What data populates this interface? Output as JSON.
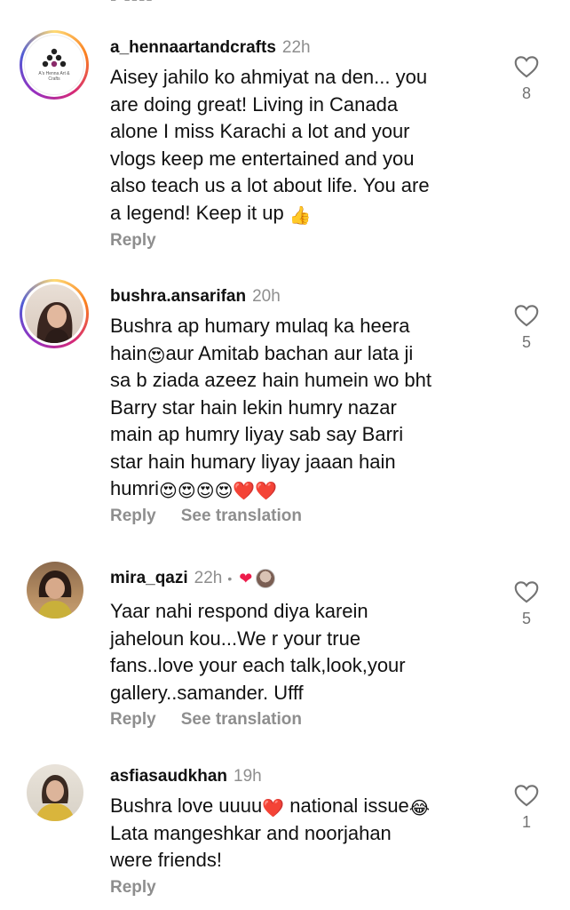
{
  "top_fragment": "- ----",
  "comments": [
    {
      "username": "a_hennaartandcrafts",
      "time": "22h",
      "text_lines": [
        "Aisey jahilo ko ahmiyat na den... you",
        "are doing great! Living in Canada",
        "alone I miss Karachi a lot and your",
        "vlogs keep me entertained and you",
        "also teach us a lot about life. You are",
        "a legend! Keep it up"
      ],
      "text_end_emoji": "👍",
      "reply": "Reply",
      "likes": "8",
      "avatar_caption": "A's Henna Art & Crafts",
      "avatar_icon": "henna-logo-icon"
    },
    {
      "username": "bushra.ansarifan",
      "time": "20h",
      "text_lines": [
        "Bushra ap humary mulaq ka heera",
        "hain",
        "sa b ziada azeez hain humein wo bht",
        "Barry star hain lekin humry nazar",
        "main ap humry liyay sab say Barri",
        "star hain humary liyay jaaan hain",
        "humri"
      ],
      "line2_emoji": "😍",
      "line2_rest": "aur Amitab bachan aur lata ji",
      "line7_emojis": "😍😍😍😍❤️❤️",
      "reply": "Reply",
      "see_translation": "See translation",
      "likes": "5"
    },
    {
      "username": "mira_qazi",
      "time": "22h",
      "dot": "•",
      "creator_heart": "❤",
      "text_lines": [
        "Yaar nahi respond diya karein",
        "jaheloun kou...We r your true",
        "fans..love your each talk,look,your",
        "gallery..samander. Ufff"
      ],
      "reply": "Reply",
      "see_translation": "See translation",
      "likes": "5"
    },
    {
      "username": "asfiasaudkhan",
      "time": "19h",
      "text_line1_a": "Bushra love uuuu",
      "text_line1_heart": "❤️",
      "text_line1_b": " national issue",
      "text_line1_emoji": "😂",
      "text_line2": "Lata mangeshkar and noorjahan",
      "text_line3": "were friends!",
      "reply": "Reply",
      "likes": "1"
    }
  ],
  "colors": {
    "secondary_text": "#8e8e8e",
    "like_heart": "#737373",
    "creator_heart": "#ed1c4b",
    "story_ring": [
      "#feda75",
      "#fa7e1e",
      "#d62976",
      "#962fbf",
      "#4f5bd5"
    ]
  }
}
